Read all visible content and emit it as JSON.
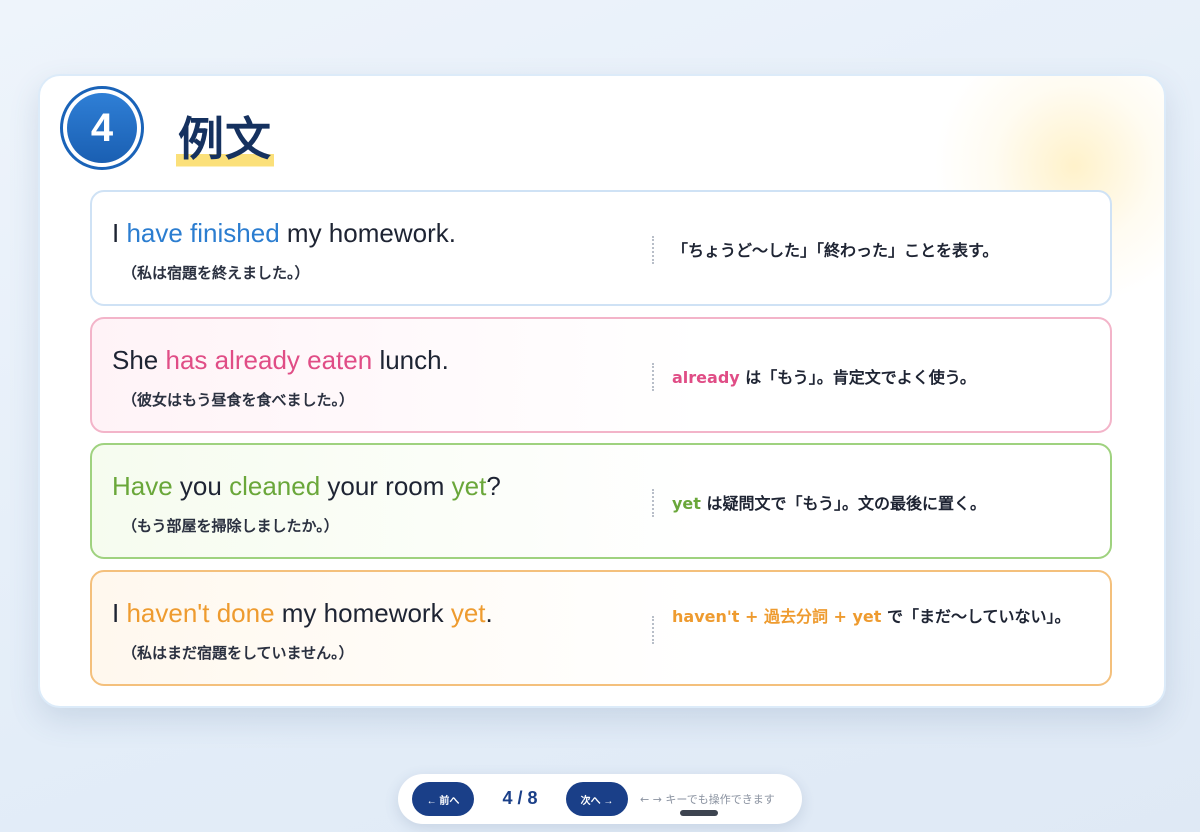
{
  "slide": {
    "number": "4",
    "title": "例文"
  },
  "examples": [
    {
      "english": [
        {
          "text": "I ",
          "hl": false
        },
        {
          "text": "have finished",
          "hl": true
        },
        {
          "text": " my homework.",
          "hl": false
        }
      ],
      "japanese": "（私は宿題を終えました。）",
      "note": [
        {
          "text": "「ちょうど〜した」「終わった」ことを表す。",
          "hl": false
        }
      ],
      "accent": "#2b7dd0"
    },
    {
      "english": [
        {
          "text": "She ",
          "hl": false
        },
        {
          "text": "has already eaten",
          "hl": true
        },
        {
          "text": " lunch.",
          "hl": false
        }
      ],
      "japanese": "（彼女はもう昼食を食べました。）",
      "note": [
        {
          "text": "already",
          "hl": true
        },
        {
          "text": " は「もう」。肯定文でよく使う。",
          "hl": false
        }
      ],
      "accent": "#e04d86"
    },
    {
      "english": [
        {
          "text": "Have",
          "hl": true
        },
        {
          "text": " you ",
          "hl": false
        },
        {
          "text": "cleaned",
          "hl": true
        },
        {
          "text": " your room ",
          "hl": false
        },
        {
          "text": "yet",
          "hl": true
        },
        {
          "text": "?",
          "hl": false
        }
      ],
      "japanese": "（もう部屋を掃除しましたか。）",
      "note": [
        {
          "text": "yet",
          "hl": true
        },
        {
          "text": " は疑問文で「もう」。文の最後に置く。",
          "hl": false
        }
      ],
      "accent": "#6aa73a"
    },
    {
      "english": [
        {
          "text": "I ",
          "hl": false
        },
        {
          "text": "haven't done",
          "hl": true
        },
        {
          "text": " my homework ",
          "hl": false
        },
        {
          "text": "yet",
          "hl": true
        },
        {
          "text": ".",
          "hl": false
        }
      ],
      "japanese": "（私はまだ宿題をしていません。）",
      "note": [
        {
          "text": "haven't + 過去分詞 + yet",
          "hl": true
        },
        {
          "text": " で「まだ〜していない」。",
          "hl": false
        }
      ],
      "accent": "#ee9b2f"
    }
  ],
  "nav": {
    "prev_label": "← 前へ",
    "next_label": "次へ →",
    "page_current": 4,
    "page_total": 8,
    "page_text": "4 / 8",
    "hint": "← → キーでも操作できます"
  }
}
